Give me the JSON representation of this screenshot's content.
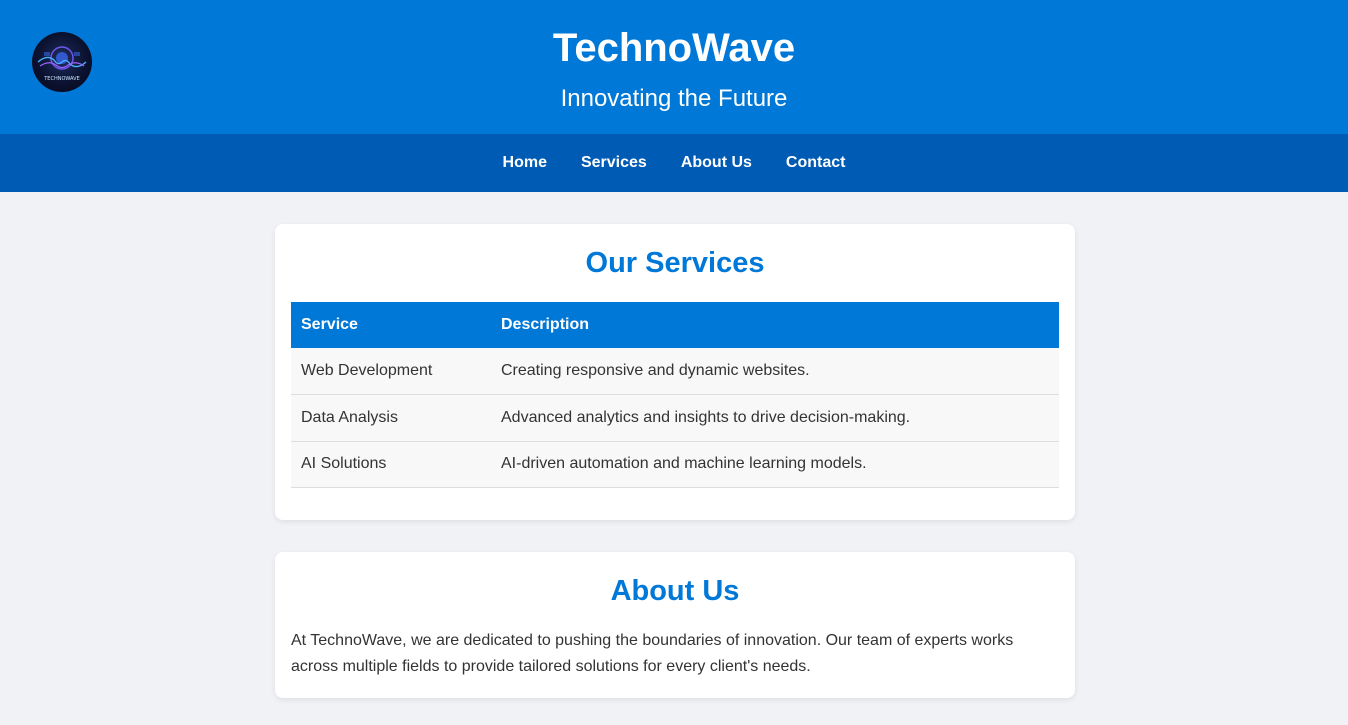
{
  "header": {
    "title": "TechnoWave",
    "subtitle": "Innovating the Future",
    "logo_text": "TECHNOWAVE"
  },
  "nav": {
    "items": [
      {
        "label": "Home"
      },
      {
        "label": "Services"
      },
      {
        "label": "About Us"
      },
      {
        "label": "Contact"
      }
    ]
  },
  "services": {
    "heading": "Our Services",
    "columns": [
      "Service",
      "Description"
    ],
    "rows": [
      {
        "service": "Web Development",
        "description": "Creating responsive and dynamic websites."
      },
      {
        "service": "Data Analysis",
        "description": "Advanced analytics and insights to drive decision-making."
      },
      {
        "service": "AI Solutions",
        "description": "AI-driven automation and machine learning models."
      }
    ]
  },
  "about": {
    "heading": "About Us",
    "text": "At TechnoWave, we are dedicated to pushing the boundaries of innovation. Our team of experts works across multiple fields to provide tailored solutions for every client's needs."
  },
  "colors": {
    "header_bg": "#0078d7",
    "nav_bg": "#005bb5",
    "page_bg": "#f0f2f5",
    "accent": "#0078d7"
  }
}
